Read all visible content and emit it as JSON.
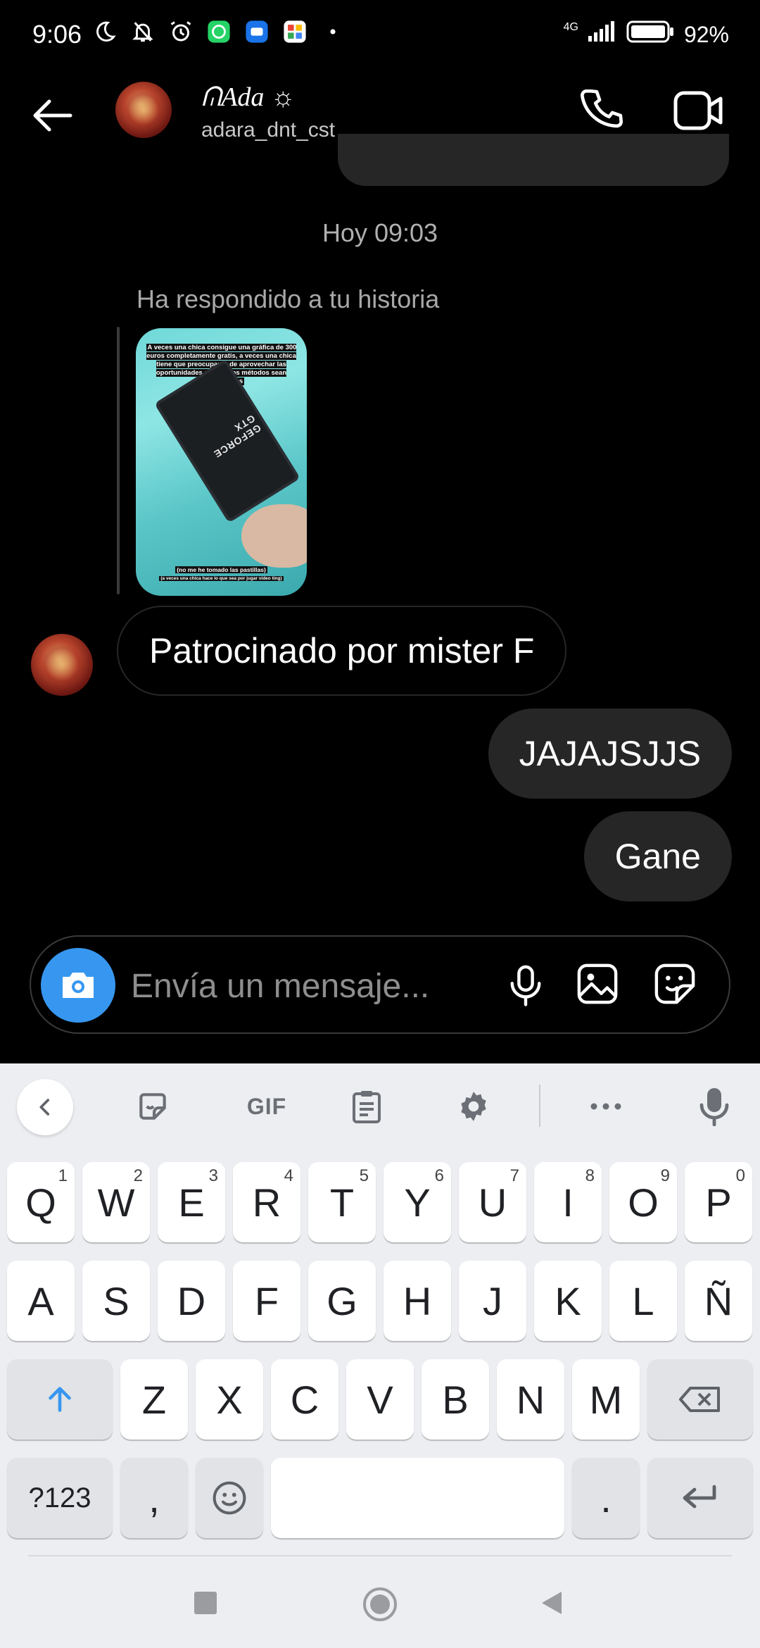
{
  "status_bar": {
    "time": "9:06",
    "network": "4G",
    "battery": "92%"
  },
  "header": {
    "name": "ᕬAda ☼",
    "username": "adara_dnt_cst"
  },
  "chat": {
    "timestamp": "Hoy 09:03",
    "reply_label": "Ha respondido a tu historia",
    "story": {
      "top_text": "A veces una chica consigue una gráfica de 300 euros completamente gratis, a veces una chica tiene que preocuparse de aprovechar las oportunidades aunque los métodos sean cuestionables",
      "gpu_text": "GEFORCE GTX",
      "bottom_text": "(no me he tomado las pastillas)",
      "bottom_small": "(a veces una chica hace lo que sea por jugar video ting)"
    },
    "messages": [
      {
        "from": "them",
        "text": "Patrocinado por mister F"
      },
      {
        "from": "me",
        "text": "JAJAJSJJS"
      },
      {
        "from": "me",
        "text": "Gane"
      }
    ]
  },
  "composer": {
    "placeholder": "Envía un mensaje..."
  },
  "keyboard": {
    "toolbar": {
      "gif": "GIF"
    },
    "row1": [
      {
        "k": "Q",
        "h": "1"
      },
      {
        "k": "W",
        "h": "2"
      },
      {
        "k": "E",
        "h": "3"
      },
      {
        "k": "R",
        "h": "4"
      },
      {
        "k": "T",
        "h": "5"
      },
      {
        "k": "Y",
        "h": "6"
      },
      {
        "k": "U",
        "h": "7"
      },
      {
        "k": "I",
        "h": "8"
      },
      {
        "k": "O",
        "h": "9"
      },
      {
        "k": "P",
        "h": "0"
      }
    ],
    "row2": [
      "A",
      "S",
      "D",
      "F",
      "G",
      "H",
      "J",
      "K",
      "L",
      "Ñ"
    ],
    "row3": [
      "Z",
      "X",
      "C",
      "V",
      "B",
      "N",
      "M"
    ],
    "row4": {
      "symbols": "?123",
      "comma": ",",
      "period": "."
    }
  },
  "colors": {
    "accent": "#3797f0",
    "bubble_out": "#262626",
    "keyboard_bg": "#eceef1"
  }
}
